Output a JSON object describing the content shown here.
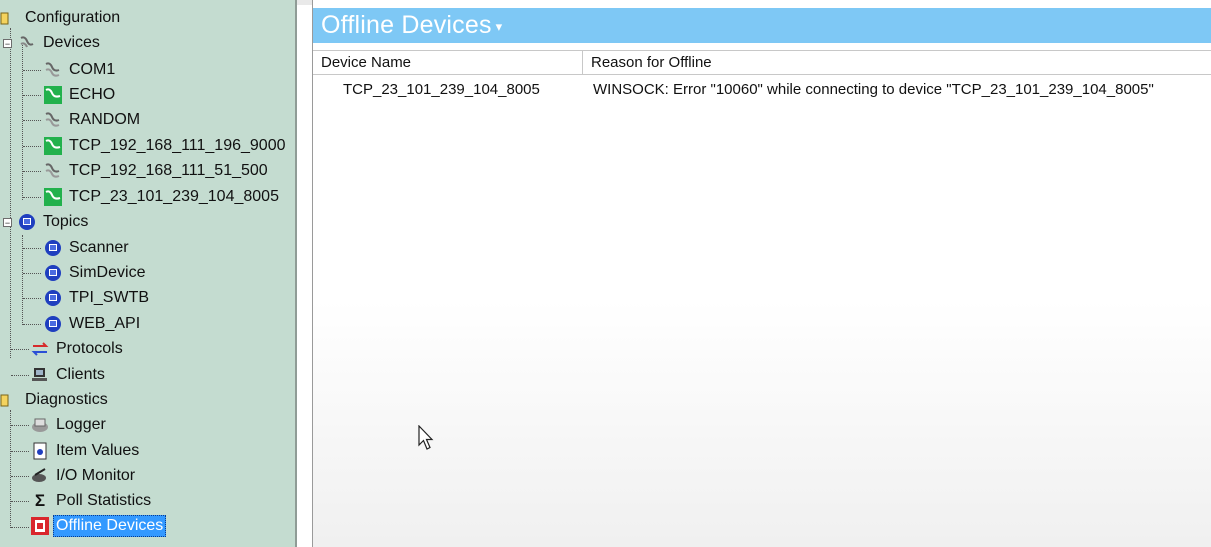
{
  "tree": {
    "configuration": "Configuration",
    "devices": "Devices",
    "device_items": [
      "COM1",
      "ECHO",
      "RANDOM",
      "TCP_192_168_111_196_9000",
      "TCP_192_168_111_51_500",
      "TCP_23_101_239_104_8005"
    ],
    "topics": "Topics",
    "topic_items": [
      "Scanner",
      "SimDevice",
      "TPI_SWTB",
      "WEB_API"
    ],
    "protocols": "Protocols",
    "clients": "Clients",
    "diagnostics": "Diagnostics",
    "diag_items": [
      "Logger",
      "Item Values",
      "I/O Monitor",
      "Poll Statistics",
      "Offline Devices"
    ]
  },
  "panel": {
    "title": "Offline Devices",
    "caret": "▾",
    "columns": [
      "Device Name",
      "Reason for Offline"
    ],
    "rows": [
      {
        "name": "TCP_23_101_239_104_8005",
        "reason": "WINSOCK: Error \"10060\" while connecting to device \"TCP_23_101_239_104_8005\""
      }
    ]
  },
  "colors": {
    "title_bar": "#7ec8f5",
    "tree_bg": "#c4dcd0",
    "selection": "#3399ff",
    "online_icon": "#22b14c"
  }
}
